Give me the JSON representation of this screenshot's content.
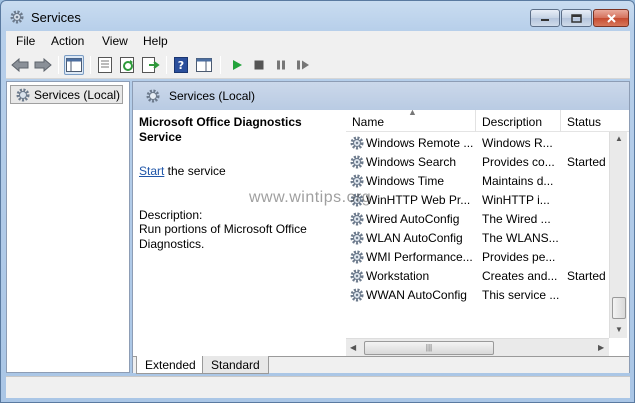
{
  "window": {
    "title": "Services"
  },
  "menu": [
    "File",
    "Action",
    "View",
    "Help"
  ],
  "tree": {
    "item": "Services (Local)"
  },
  "pane_title": "Services (Local)",
  "details": {
    "service_name": "Microsoft Office Diagnostics Service",
    "start_link": "Start",
    "start_suffix": " the service",
    "description_label": "Description:",
    "description_text": "Run portions of Microsoft Office Diagnostics."
  },
  "columns": {
    "name": "Name",
    "description": "Description",
    "status": "Status"
  },
  "services": [
    {
      "name": "Windows Remote ...",
      "description": "Windows R...",
      "status": ""
    },
    {
      "name": "Windows Search",
      "description": "Provides co...",
      "status": "Started"
    },
    {
      "name": "Windows Time",
      "description": "Maintains d...",
      "status": ""
    },
    {
      "name": "WinHTTP Web Pr...",
      "description": "WinHTTP i...",
      "status": ""
    },
    {
      "name": "Wired AutoConfig",
      "description": "The Wired ...",
      "status": ""
    },
    {
      "name": "WLAN AutoConfig",
      "description": "The WLANS...",
      "status": ""
    },
    {
      "name": "WMI Performance...",
      "description": "Provides pe...",
      "status": ""
    },
    {
      "name": "Workstation",
      "description": "Creates and...",
      "status": "Started"
    },
    {
      "name": "WWAN AutoConfig",
      "description": "This service ...",
      "status": ""
    }
  ],
  "tabs": {
    "extended": "Extended",
    "standard": "Standard"
  },
  "watermark": "www.wintips.org"
}
